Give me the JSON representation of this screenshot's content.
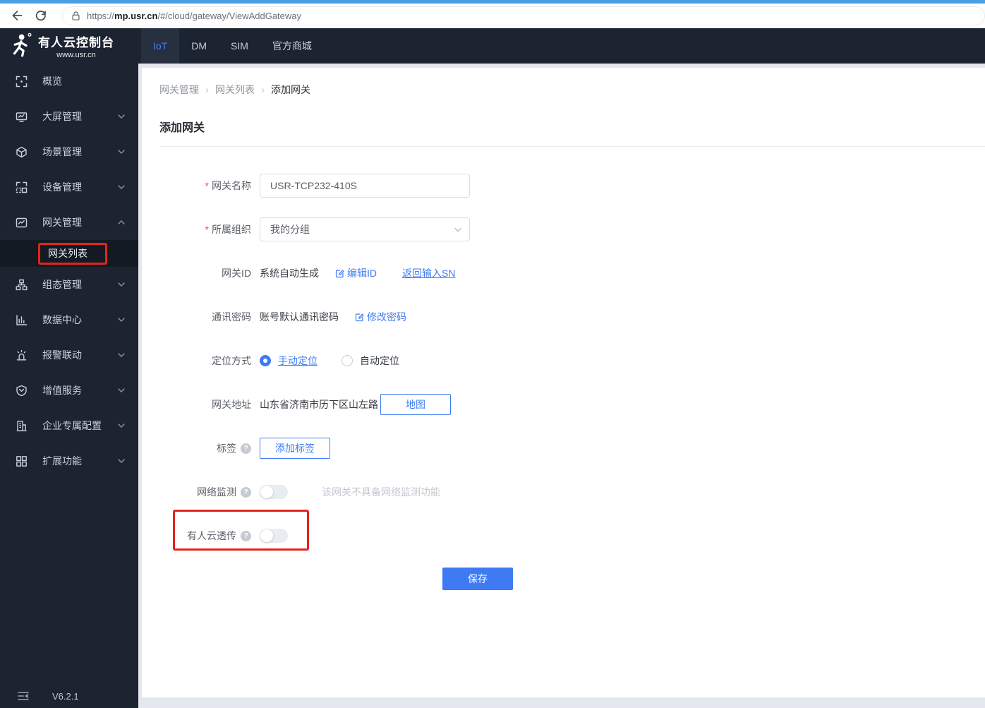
{
  "browser": {
    "url_protocol": "https://",
    "url_domain": "mp.usr.cn",
    "url_path": "/#/cloud/gateway/ViewAddGateway"
  },
  "header": {
    "logo_title": "有人云控制台",
    "logo_subtitle": "www.usr.cn",
    "tabs": [
      {
        "label": "IoT",
        "active": true
      },
      {
        "label": "DM",
        "active": false
      },
      {
        "label": "SIM",
        "active": false
      },
      {
        "label": "官方商城",
        "active": false
      }
    ]
  },
  "sidebar": {
    "items": [
      {
        "label": "概览"
      },
      {
        "label": "大屏管理"
      },
      {
        "label": "场景管理"
      },
      {
        "label": "设备管理"
      },
      {
        "label": "网关管理"
      },
      {
        "label": "组态管理"
      },
      {
        "label": "数据中心"
      },
      {
        "label": "报警联动"
      },
      {
        "label": "增值服务"
      },
      {
        "label": "企业专属配置"
      },
      {
        "label": "扩展功能"
      }
    ],
    "submenu_item": "网关列表",
    "version": "V6.2.1"
  },
  "breadcrumb": {
    "items": [
      "网关管理",
      "网关列表",
      "添加网关"
    ]
  },
  "page": {
    "title": "添加网关"
  },
  "form": {
    "required_marker": "*",
    "name": {
      "label": "网关名称",
      "value": "USR-TCP232-410S"
    },
    "org": {
      "label": "所属组织",
      "value": "我的分组"
    },
    "id": {
      "label": "网关ID",
      "value": "系统自动生成",
      "edit_link": "编辑ID",
      "sn_link": "返回输入SN"
    },
    "password": {
      "label": "通讯密码",
      "value": "账号默认通讯密码",
      "edit_link": "修改密码"
    },
    "location": {
      "label": "定位方式",
      "manual": "手动定位",
      "auto": "自动定位"
    },
    "address": {
      "label": "网关地址",
      "value": "山东省济南市历下区山左路",
      "map_button": "地图"
    },
    "tag": {
      "label": "标签",
      "add_button": "添加标签"
    },
    "monitor": {
      "label": "网络监测",
      "hint": "该网关不具备网络监测功能",
      "state": "off"
    },
    "passthrough": {
      "label": "有人云透传",
      "state": "off"
    },
    "save_button": "保存"
  },
  "colors": {
    "accent": "#3e7bf2",
    "header_bg": "#1c2432",
    "submenu_bg": "#141a24",
    "page_bg": "#e4e7ee",
    "annotation_red": "#e1251b",
    "chrome_accent": "#4aa0e4"
  }
}
